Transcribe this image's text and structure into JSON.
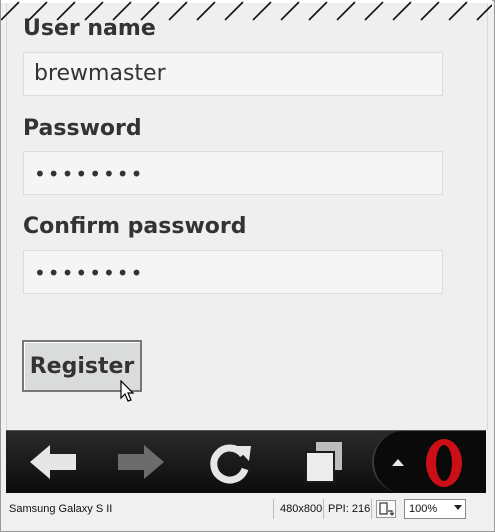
{
  "form": {
    "username_label": "User name",
    "username_value": "brewmaster",
    "password_label": "Password",
    "password_value": "••••••••",
    "confirm_label": "Confirm password",
    "confirm_value": "••••••••",
    "register_label": "Register"
  },
  "toolbar": {
    "back_icon": "back-arrow-icon",
    "forward_icon": "forward-arrow-icon",
    "reload_icon": "reload-icon",
    "tabs_icon": "tabs-icon",
    "menu_icon": "menu-up-icon",
    "opera_icon": "opera-logo-icon",
    "opera_color": "#cc0f16"
  },
  "status": {
    "device": "Samsung Galaxy S II",
    "resolution": "480x800",
    "ppi": "PPI: 216",
    "zoom": "100%"
  }
}
